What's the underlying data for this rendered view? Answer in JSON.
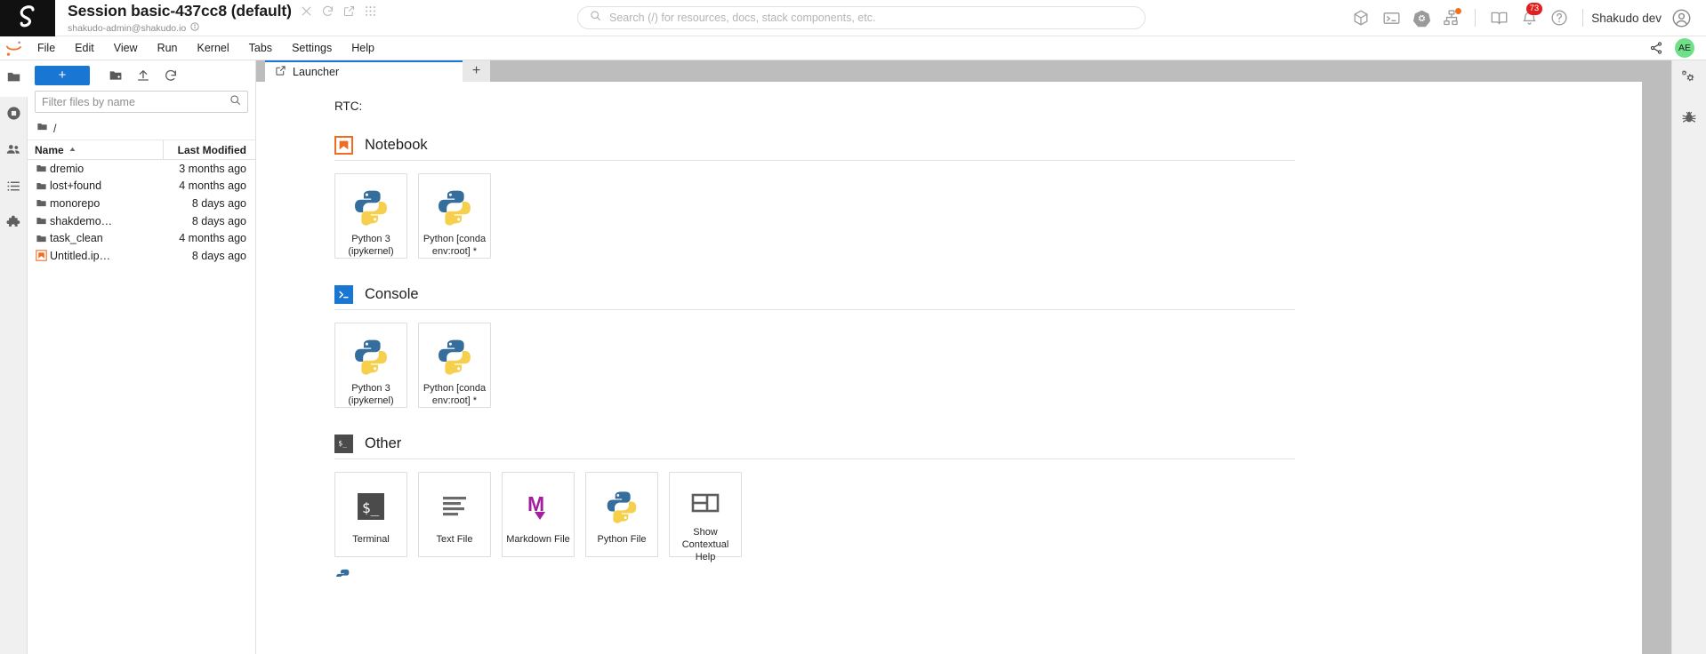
{
  "shakudo_header": {
    "logo": "shakudo-logo",
    "session_title": "Session basic-437cc8 (default)",
    "user_email": "shakudo-admin@shakudo.io",
    "title_icons": [
      {
        "name": "close-session-icon",
        "glyph": "close"
      },
      {
        "name": "refresh-session-icon",
        "glyph": "refresh"
      },
      {
        "name": "open-external-icon",
        "glyph": "external"
      },
      {
        "name": "apps-grid-icon",
        "glyph": "grid"
      }
    ],
    "search": {
      "placeholder": "Search (/) for resources, docs, stack components, etc.",
      "value": ""
    },
    "right_icons": [
      {
        "name": "cube-icon",
        "label": "Resources"
      },
      {
        "name": "terminal-icon",
        "label": "Terminal"
      },
      {
        "name": "kubernetes-icon",
        "label": "Kubernetes"
      },
      {
        "name": "pipeline-graph-icon",
        "label": "Pipelines",
        "status_dot": "#f2711c"
      },
      {
        "name": "book-icon",
        "label": "Docs"
      },
      {
        "name": "bell-icon",
        "label": "Notifications",
        "badge": "73"
      },
      {
        "name": "help-circle-icon",
        "label": "Help"
      }
    ],
    "notification_badge": "73",
    "account_name": "Shakudo dev",
    "account_icon": "user-circle-icon"
  },
  "menubar": {
    "logo": "jupyter-logo",
    "items": [
      {
        "label": "File"
      },
      {
        "label": "Edit"
      },
      {
        "label": "View"
      },
      {
        "label": "Run"
      },
      {
        "label": "Kernel"
      },
      {
        "label": "Tabs"
      },
      {
        "label": "Settings"
      },
      {
        "label": "Help"
      }
    ],
    "share_icon": "share-icon",
    "avatar_initials": "AE",
    "avatar_color": "#6fe08a"
  },
  "left_rail": [
    {
      "name": "sidebar-item-file-browser",
      "icon": "folder-icon",
      "active": true
    },
    {
      "name": "sidebar-item-running-kernels",
      "icon": "stop-circle-icon",
      "active": false
    },
    {
      "name": "sidebar-item-collaboration",
      "icon": "people-icon",
      "active": false
    },
    {
      "name": "sidebar-item-table-of-contents",
      "icon": "list-icon",
      "active": false
    },
    {
      "name": "sidebar-item-extensions",
      "icon": "puzzle-icon",
      "active": false
    }
  ],
  "right_rail": [
    {
      "name": "sidebar-item-property-inspector",
      "icon": "gears-icon"
    },
    {
      "name": "sidebar-item-debugger",
      "icon": "bug-icon"
    }
  ],
  "file_browser": {
    "new_button_label": "+",
    "toolbar_icons": [
      {
        "name": "new-folder-icon"
      },
      {
        "name": "upload-icon"
      },
      {
        "name": "refresh-icon"
      }
    ],
    "filter": {
      "placeholder": "Filter files by name",
      "value": ""
    },
    "breadcrumb": "/",
    "columns": {
      "name": "Name",
      "last_modified": "Last Modified"
    },
    "sort_indicator": "ascending",
    "rows": [
      {
        "icon": "folder-icon",
        "name": "dremio",
        "modified": "3 months ago"
      },
      {
        "icon": "folder-icon",
        "name": "lost+found",
        "modified": "4 months ago"
      },
      {
        "icon": "folder-icon",
        "name": "monorepo",
        "modified": "8 days ago"
      },
      {
        "icon": "folder-icon",
        "name": "shakdemo…",
        "modified": "8 days ago"
      },
      {
        "icon": "folder-icon",
        "name": "task_clean",
        "modified": "4 months ago"
      },
      {
        "icon": "notebook-icon",
        "name": "Untitled.ip…",
        "modified": "8 days ago"
      }
    ]
  },
  "main": {
    "tabs": [
      {
        "label": "Launcher",
        "icon": "launcher-icon",
        "active": true
      }
    ],
    "add_tab_label": "+",
    "launcher": {
      "rtc_label": "RTC:",
      "sections": [
        {
          "title": "Notebook",
          "icon": "notebook-section-icon",
          "icon_color": "#ee6c24",
          "cards": [
            {
              "label": "Python 3 (ipykernel)",
              "icon": "python-icon"
            },
            {
              "label": "Python [conda env:root] *",
              "icon": "python-icon"
            }
          ]
        },
        {
          "title": "Console",
          "icon": "console-section-icon",
          "icon_color": "#1976d2",
          "cards": [
            {
              "label": "Python 3 (ipykernel)",
              "icon": "python-icon"
            },
            {
              "label": "Python [conda env:root] *",
              "icon": "python-icon"
            }
          ]
        },
        {
          "title": "Other",
          "icon": "other-section-icon",
          "icon_color": "#4b4b4b",
          "cards": [
            {
              "label": "Terminal",
              "icon": "terminal-icon"
            },
            {
              "label": "Text File",
              "icon": "text-file-icon"
            },
            {
              "label": "Markdown File",
              "icon": "markdown-icon"
            },
            {
              "label": "Python File",
              "icon": "python-icon"
            },
            {
              "label": "Show Contextual Help",
              "icon": "contextual-help-icon"
            }
          ]
        }
      ]
    }
  }
}
